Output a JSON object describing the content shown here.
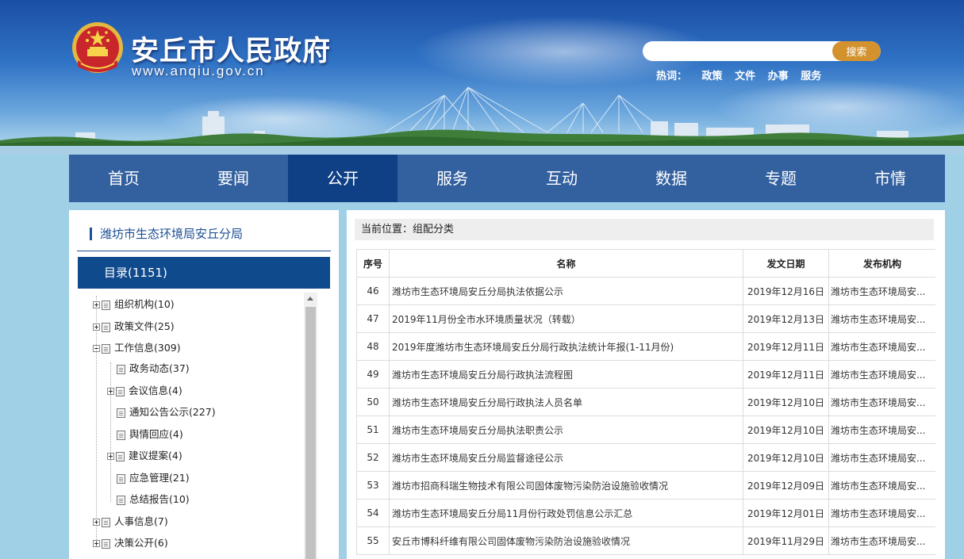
{
  "header": {
    "site_title": "安丘市人民政府",
    "site_url": "www.anqiu.gov.cn",
    "search": {
      "placeholder": "",
      "button_label": "搜索"
    },
    "hotwords_label": "热词：",
    "hotwords": [
      "政策",
      "文件",
      "办事",
      "服务"
    ]
  },
  "nav": {
    "items": [
      "首页",
      "要闻",
      "公开",
      "服务",
      "互动",
      "数据",
      "专题",
      "市情"
    ],
    "active": "公开"
  },
  "sidebar": {
    "department": "潍坊市生态环境局安丘分局",
    "catalog_label": "目录(1151)",
    "tree": [
      {
        "label": "组织机构(10)",
        "expanded": false
      },
      {
        "label": "政策文件(25)",
        "expanded": false
      },
      {
        "label": "工作信息(309)",
        "expanded": true
      },
      {
        "label": "政务动态(37)"
      },
      {
        "label": "会议信息(4)",
        "expanded": false
      },
      {
        "label": "通知公告公示(227)"
      },
      {
        "label": "舆情回应(4)"
      },
      {
        "label": "建议提案(4)",
        "expanded": false
      },
      {
        "label": "应急管理(21)"
      },
      {
        "label": "总结报告(10)"
      },
      {
        "label": "人事信息(7)",
        "expanded": false
      },
      {
        "label": "决策公开(6)",
        "expanded": false
      }
    ]
  },
  "main": {
    "breadcrumb": "当前位置：组配分类",
    "columns": [
      "序号",
      "名称",
      "发文日期",
      "发布机构"
    ],
    "rows": [
      {
        "no": "46",
        "title": "潍坊市生态环境局安丘分局执法依据公示",
        "date": "2019年12月16日",
        "org": "潍坊市生态环境局安..."
      },
      {
        "no": "47",
        "title": "2019年11月份全市水环境质量状况（转载）",
        "date": "2019年12月13日",
        "org": "潍坊市生态环境局安..."
      },
      {
        "no": "48",
        "title": "2019年度潍坊市生态环境局安丘分局行政执法统计年报(1-11月份)",
        "date": "2019年12月11日",
        "org": "潍坊市生态环境局安..."
      },
      {
        "no": "49",
        "title": "潍坊市生态环境局安丘分局行政执法流程图",
        "date": "2019年12月11日",
        "org": "潍坊市生态环境局安..."
      },
      {
        "no": "50",
        "title": "潍坊市生态环境局安丘分局行政执法人员名单",
        "date": "2019年12月10日",
        "org": "潍坊市生态环境局安..."
      },
      {
        "no": "51",
        "title": "潍坊市生态环境局安丘分局执法职责公示",
        "date": "2019年12月10日",
        "org": "潍坊市生态环境局安..."
      },
      {
        "no": "52",
        "title": "潍坊市生态环境局安丘分局监督途径公示",
        "date": "2019年12月10日",
        "org": "潍坊市生态环境局安..."
      },
      {
        "no": "53",
        "title": "潍坊市招商科瑞生物技术有限公司固体废物污染防治设施验收情况",
        "date": "2019年12月09日",
        "org": "潍坊市生态环境局安..."
      },
      {
        "no": "54",
        "title": "潍坊市生态环境局安丘分局11月份行政处罚信息公示汇总",
        "date": "2019年12月01日",
        "org": "潍坊市生态环境局安..."
      },
      {
        "no": "55",
        "title": "安丘市博科纤维有限公司固体废物污染防治设施验收情况",
        "date": "2019年11月29日",
        "org": "潍坊市生态环境局安..."
      }
    ]
  },
  "colors": {
    "nav_bg": "#33609f",
    "nav_active": "#0f3f84",
    "catalog_bg": "#0f4a8c",
    "search_button": "#d3922e",
    "page_bg": "#9fd0e6"
  },
  "icons": [
    "national-emblem-icon",
    "tree-plus-icon",
    "tree-minus-icon",
    "document-icon",
    "scroll-up-arrow-icon"
  ]
}
